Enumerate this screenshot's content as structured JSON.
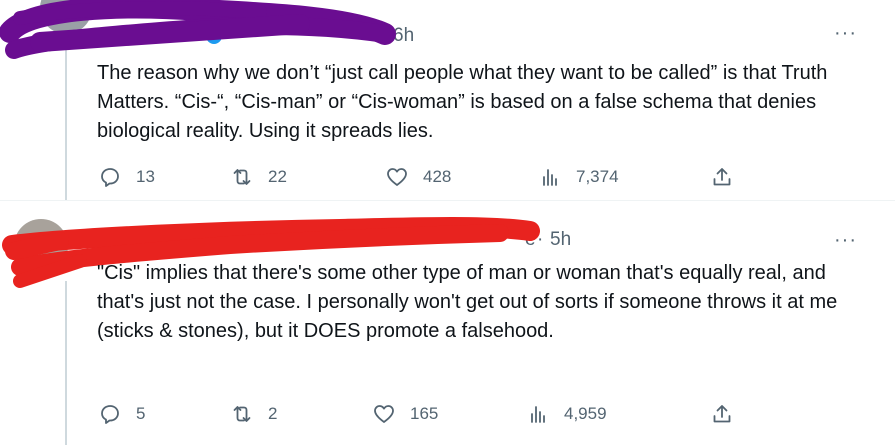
{
  "tweets": [
    {
      "time": "6h",
      "more": "···",
      "text": "The reason why we don’t “just call people what they want to be called” is that Truth Matters. “Cis-“, “Cis-man” or “Cis-woman” is based on a false schema that denies biological reality. Using it spreads lies.",
      "actions": {
        "replies": "13",
        "retweets": "22",
        "likes": "428",
        "views": "7,374"
      }
    },
    {
      "handle_fragment": "e",
      "time_prefix": "·",
      "time": "5h",
      "more": "···",
      "text": "\"Cis\" implies that there's some other type of man or woman that's equally real, and that's just not the case. I personally won't get out of sorts if someone throws it at me (sticks & stones), but it DOES promote a falsehood.",
      "actions": {
        "replies": "5",
        "retweets": "2",
        "likes": "165",
        "views": "4,959"
      }
    }
  ],
  "colors": {
    "text": "#0f1419",
    "secondary": "#536471",
    "verified": "#1d9bf0",
    "scribble_top": "#6a0d91",
    "scribble_bottom": "#e8231f",
    "divider": "#eff3f4"
  },
  "icons": [
    "reply-icon",
    "retweet-icon",
    "like-icon",
    "views-icon",
    "share-icon",
    "more-icon",
    "verified-badge-icon"
  ]
}
